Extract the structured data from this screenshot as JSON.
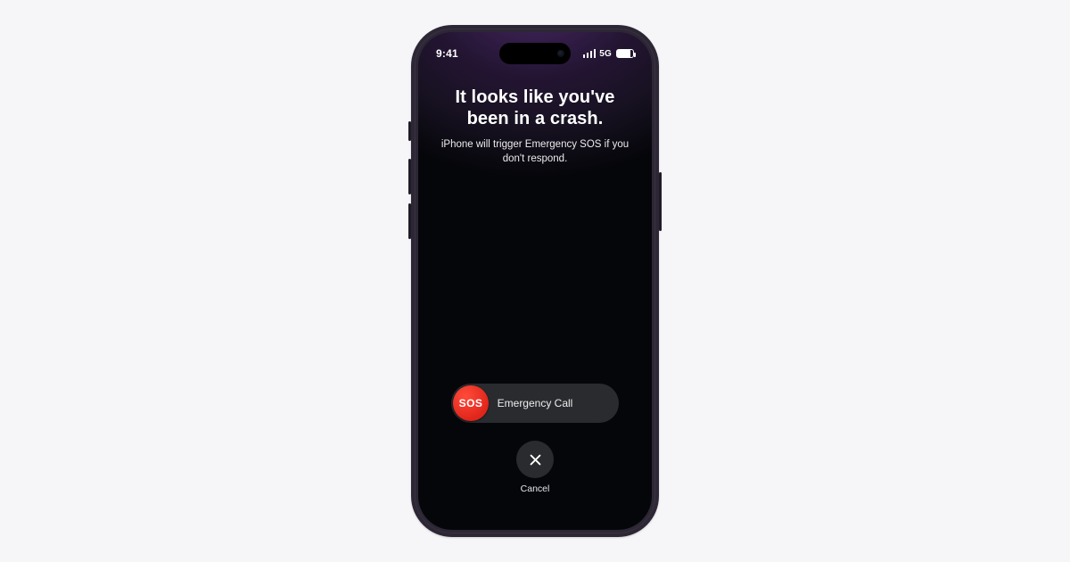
{
  "status": {
    "time": "9:41",
    "network_label": "5G",
    "signal_icon": "cellular-bars-icon",
    "battery_icon": "battery-full-icon"
  },
  "alert": {
    "title": "It looks like you've been in a crash.",
    "subtitle": "iPhone will trigger Emergency SOS if you don't respond."
  },
  "slider": {
    "knob_text": "SOS",
    "label": "Emergency Call"
  },
  "cancel": {
    "icon": "close-icon",
    "label": "Cancel"
  }
}
